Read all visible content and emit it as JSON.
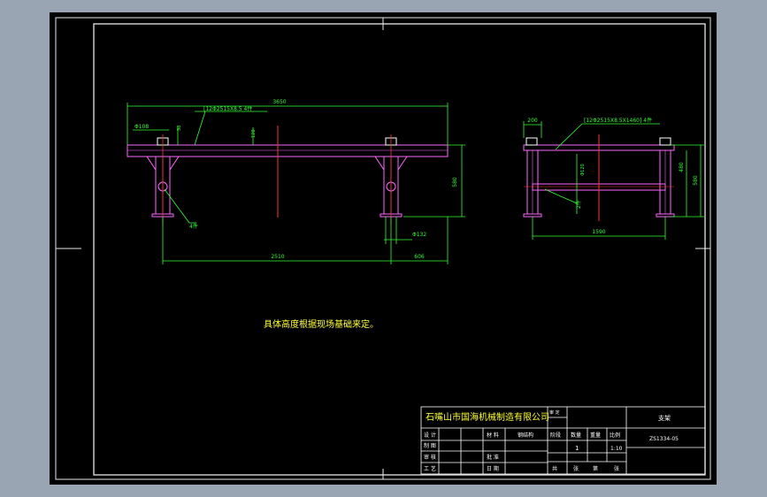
{
  "drawing": {
    "note": "具体高度根据现场基础来定。",
    "front_view": {
      "overall_length": "3650",
      "span": "2510",
      "end_offset": "606",
      "height": "580",
      "bolt_hole": "Φ108",
      "top_small": "38",
      "mid_dim": "120",
      "plate_thk": "Φ132",
      "callout": "[12Φ2515X8.5 4件",
      "leg_callout": "4件"
    },
    "side_view": {
      "width": "1590",
      "top_width": "200",
      "height_outer": "580",
      "height_inner": "480",
      "inner_dim": "Φ120",
      "callout": "[12Φ2515X8.5X1460] 4件",
      "brace_callout": "2件"
    }
  },
  "title_block": {
    "company": "石嘴山市国海机械制造有限公司",
    "row_labels": [
      "设 计",
      "制 图",
      "审 核",
      "工 艺"
    ],
    "mid_labels": [
      "材 料",
      "批 准",
      "日 期"
    ],
    "material_value": "钢结构",
    "drawing_name": "支架",
    "drawing_code": "ZS1334-05",
    "col_headers": [
      "阶段",
      "数量",
      "重量",
      "比例"
    ],
    "quantity": "1",
    "scale": "1:10",
    "sheet_labels": [
      "共",
      "张",
      "第",
      "张"
    ],
    "sign_labels": [
      "审 定"
    ]
  }
}
